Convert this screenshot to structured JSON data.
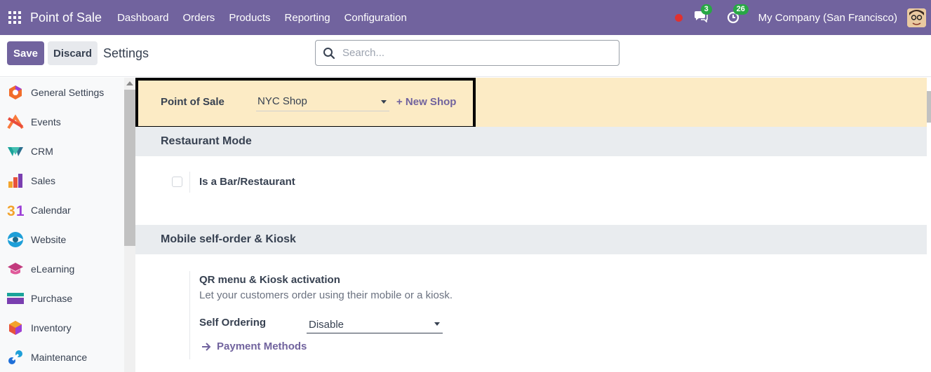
{
  "navbar": {
    "app_name": "Point of Sale",
    "menu": [
      "Dashboard",
      "Orders",
      "Products",
      "Reporting",
      "Configuration"
    ],
    "messages_count": "3",
    "activities_count": "26",
    "company": "My Company (San Francisco)"
  },
  "controlbar": {
    "save_label": "Save",
    "discard_label": "Discard",
    "title": "Settings",
    "search_placeholder": "Search..."
  },
  "sidebar": {
    "items": [
      {
        "label": "General Settings",
        "icon": "general-settings-icon"
      },
      {
        "label": "Events",
        "icon": "events-icon"
      },
      {
        "label": "CRM",
        "icon": "crm-icon"
      },
      {
        "label": "Sales",
        "icon": "sales-icon"
      },
      {
        "label": "Calendar",
        "icon": "calendar-icon"
      },
      {
        "label": "Website",
        "icon": "website-icon"
      },
      {
        "label": "eLearning",
        "icon": "elearning-icon"
      },
      {
        "label": "Purchase",
        "icon": "purchase-icon"
      },
      {
        "label": "Inventory",
        "icon": "inventory-icon"
      },
      {
        "label": "Maintenance",
        "icon": "maintenance-icon"
      }
    ]
  },
  "shop": {
    "label": "Point of Sale",
    "selected": "NYC Shop",
    "new_shop": "+ New Shop"
  },
  "restaurant": {
    "heading": "Restaurant Mode",
    "checkbox_label": "Is a Bar/Restaurant",
    "checked": false
  },
  "kiosk": {
    "heading": "Mobile self-order & Kiosk",
    "title": "QR menu & Kiosk activation",
    "description": "Let your customers order using their mobile or a kiosk.",
    "self_ordering_label": "Self Ordering",
    "self_ordering_value": "Disable",
    "payment_link": "Payment Methods"
  },
  "colors": {
    "brand": "#71639e",
    "banner": "#fcebc5",
    "section": "#e9ecef"
  }
}
